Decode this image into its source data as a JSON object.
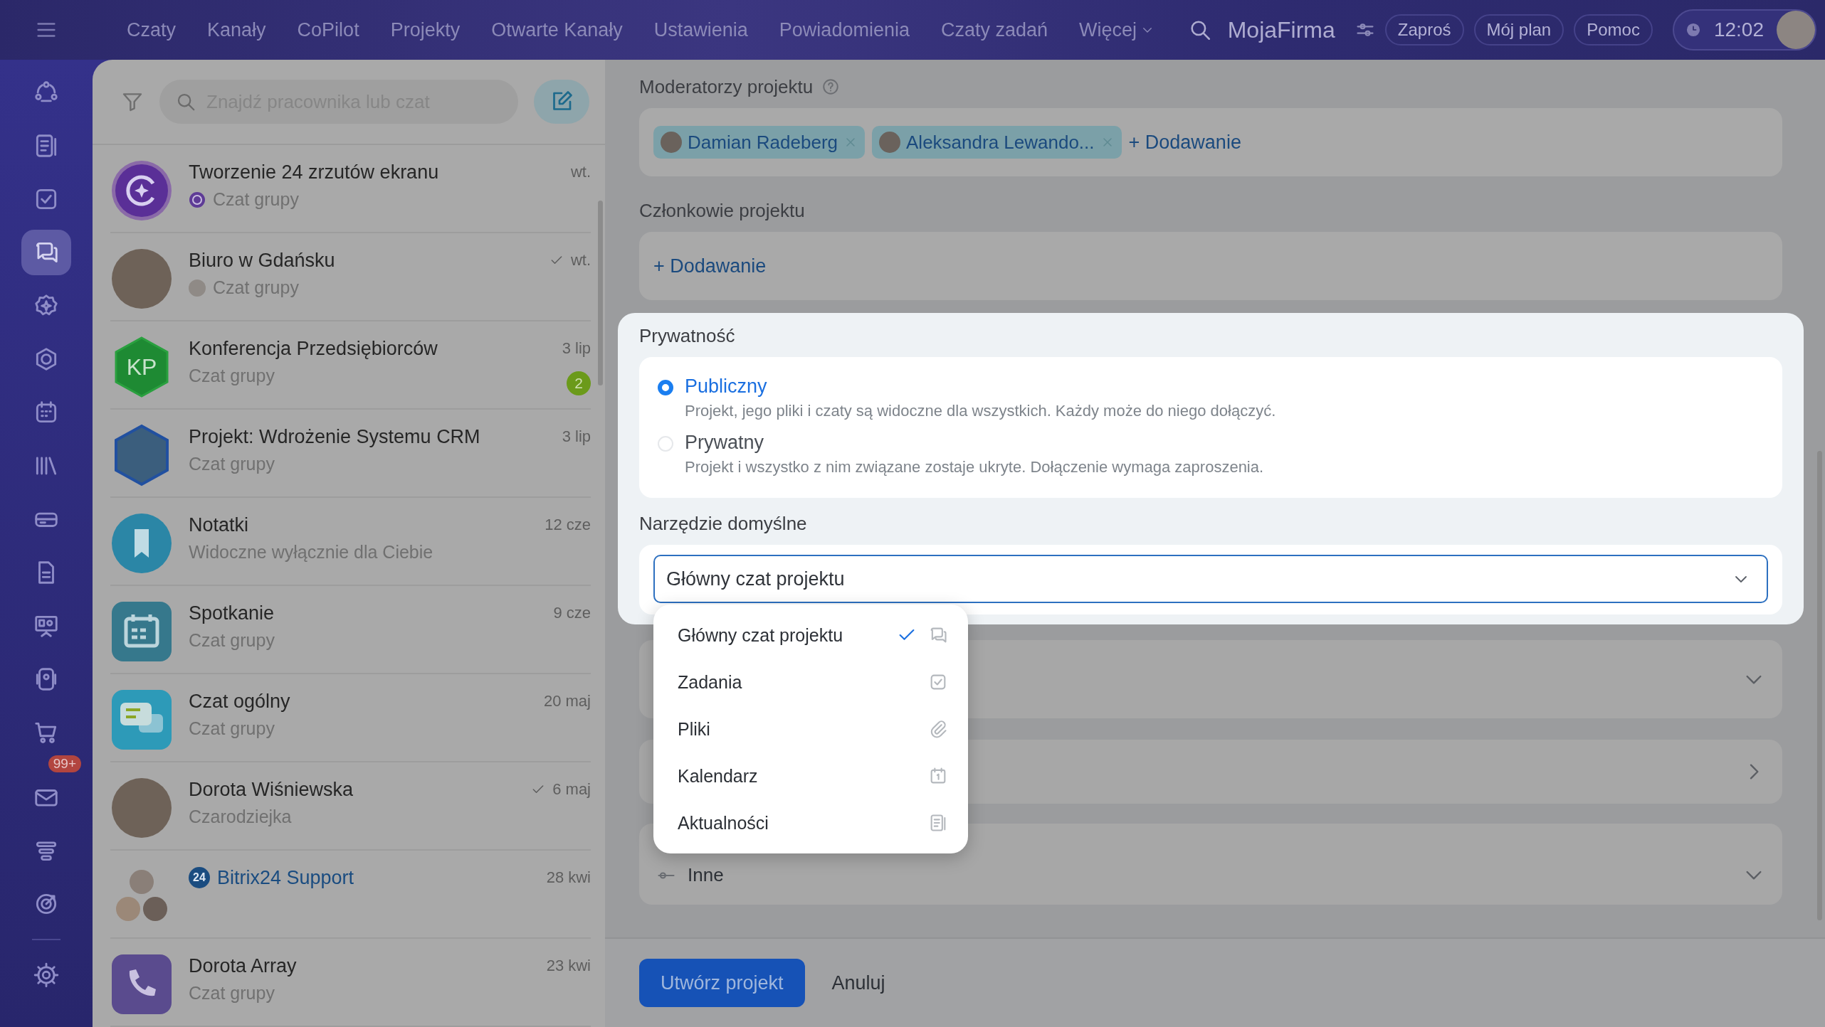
{
  "top_nav": {
    "items": [
      "Czaty",
      "Kanały",
      "CoPilot",
      "Projekty",
      "Otwarte Kanały",
      "Ustawienia",
      "Powiadomienia",
      "Czaty zadań"
    ],
    "more": "Więcej",
    "company": "MojaFirma",
    "buttons": [
      "Zaproś",
      "Mój plan",
      "Pomoc"
    ],
    "time": "12:02"
  },
  "rail": {
    "items": [
      {
        "kind": "flow",
        "selected": false
      },
      {
        "kind": "feed",
        "selected": false
      },
      {
        "kind": "tasks",
        "selected": false
      },
      {
        "kind": "chat",
        "selected": true
      },
      {
        "kind": "star",
        "selected": false
      },
      {
        "kind": "hexagon",
        "selected": false
      },
      {
        "kind": "calendar",
        "selected": false
      },
      {
        "kind": "library",
        "selected": false
      },
      {
        "kind": "drive",
        "selected": false
      },
      {
        "kind": "document",
        "selected": false
      },
      {
        "kind": "board",
        "selected": false
      },
      {
        "kind": "device",
        "selected": false
      },
      {
        "kind": "cart",
        "selected": false
      },
      {
        "kind": "mail",
        "selected": false,
        "badge": "99+"
      },
      {
        "kind": "layers",
        "selected": false
      },
      {
        "kind": "target",
        "selected": false
      },
      {
        "kind": "gear",
        "selected": false
      }
    ]
  },
  "chat_list": {
    "search_placeholder": "Znajdź pracownika lub czat",
    "chats": [
      {
        "kind": "copilot",
        "title": "Tworzenie 24 zrzutów ekranu",
        "subtitle": "Czat grupy",
        "date": "wt.",
        "read": false
      },
      {
        "kind": "groupphoto",
        "title": "Biuro w Gdańsku",
        "subtitle": "Czat grupy",
        "date": "wt.",
        "read": true
      },
      {
        "kind": "initials",
        "avatar_text": "KP",
        "title": "Konferencja Przedsiębiorców",
        "subtitle": "Czat grupy",
        "date": "3 lip",
        "read": false,
        "unread": "2"
      },
      {
        "kind": "screenshot",
        "title": "Projekt: Wdrożenie Systemu CRM",
        "subtitle": "Czat grupy",
        "date": "3 lip",
        "read": false
      },
      {
        "kind": "bookmark",
        "title": "Notatki",
        "subtitle": "Widoczne wyłącznie dla Ciebie",
        "date": "12 cze",
        "read": false
      },
      {
        "kind": "calendar",
        "title": "Spotkanie",
        "subtitle": "Czat grupy",
        "date": "9 cze",
        "read": false
      },
      {
        "kind": "bubbles",
        "title": "Czat ogólny",
        "subtitle": "Czat grupy",
        "date": "20 maj",
        "read": false
      },
      {
        "kind": "photo",
        "title": "Dorota Wiśniewska",
        "subtitle": "Czarodziejka",
        "date": "6 maj",
        "read": true
      },
      {
        "kind": "team",
        "title": "Bitrix24 Support",
        "title_badge": "24",
        "date": "28 kwi",
        "read": false
      },
      {
        "kind": "phone",
        "title": "Dorota Array",
        "subtitle": "Czat grupy",
        "date": "23 kwi",
        "read": false
      }
    ]
  },
  "form": {
    "moderators_label": "Moderatorzy projektu",
    "moderators": [
      {
        "name": "Damian Radeberg"
      },
      {
        "name": "Aleksandra Lewando..."
      }
    ],
    "moderators_add": "+ Dodawanie",
    "members_label": "Członkowie projektu",
    "members_add": "+ Dodawanie",
    "privacy_label": "Prywatność",
    "privacy_options": [
      {
        "title": "Publiczny",
        "description": "Projekt, jego pliki i czaty są widoczne dla wszystkich. Każdy może do niego dołączyć.",
        "selected": true
      },
      {
        "title": "Prywatny",
        "description": "Projekt i wszystko z nim związane zostaje ukryte. Dołączenie wymaga zaproszenia.",
        "selected": false
      }
    ],
    "default_tool_label": "Narzędzie domyślne",
    "default_tool_value": "Główny czat projektu",
    "dropdown": [
      {
        "label": "Główny czat projektu",
        "kind": "chat",
        "selected": true
      },
      {
        "label": "Zadania",
        "kind": "tasks",
        "selected": false
      },
      {
        "label": "Pliki",
        "kind": "clip",
        "selected": false
      },
      {
        "label": "Kalendarz",
        "kind": "calendar1",
        "selected": false
      },
      {
        "label": "Aktualności",
        "kind": "feed",
        "selected": false
      }
    ],
    "sections": [
      {
        "kind": "collapsible"
      },
      {
        "kind": "link"
      },
      {
        "kind": "collapsible",
        "label": "Inne"
      }
    ],
    "create_button": "Utwórz projekt",
    "cancel_button": "Anuluj"
  }
}
